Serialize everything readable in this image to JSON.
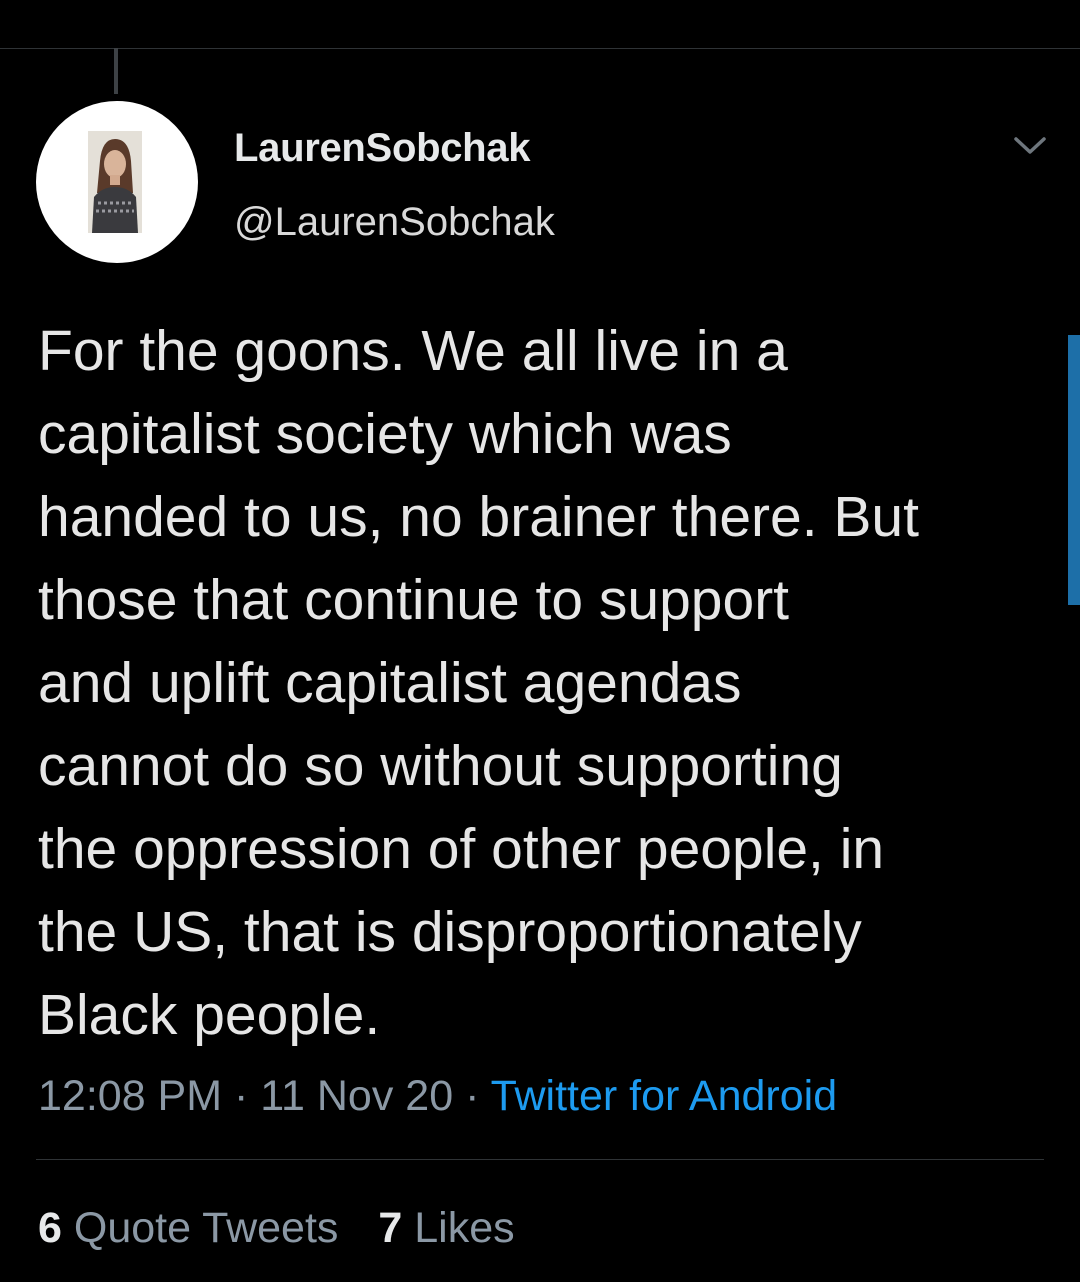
{
  "tweet": {
    "author": {
      "display_name": "LaurenSobchak",
      "handle": "@LaurenSobchak"
    },
    "text_lines": [
      "For the goons. We all live in a",
      "capitalist society which was",
      "handed to us, no brainer there. But",
      "those that continue to support",
      "and uplift capitalist agendas",
      "cannot do so without supporting",
      "the oppression of other people, in",
      "the US, that is disproportionately",
      "Black people."
    ],
    "time": "12:08 PM",
    "separator": "·",
    "date": "11 Nov 20",
    "source": "Twitter for Android",
    "stats": {
      "quote_tweets_count": "6",
      "quote_tweets_label": "Quote Tweets",
      "likes_count": "7",
      "likes_label": "Likes"
    }
  },
  "icons": {
    "more_menu": "chevron-down-icon"
  },
  "colors": {
    "background": "#000000",
    "primary_text": "#e7e9ea",
    "secondary_text": "#8b98a5",
    "link": "#1d9bf0",
    "divider": "#2f3336"
  }
}
